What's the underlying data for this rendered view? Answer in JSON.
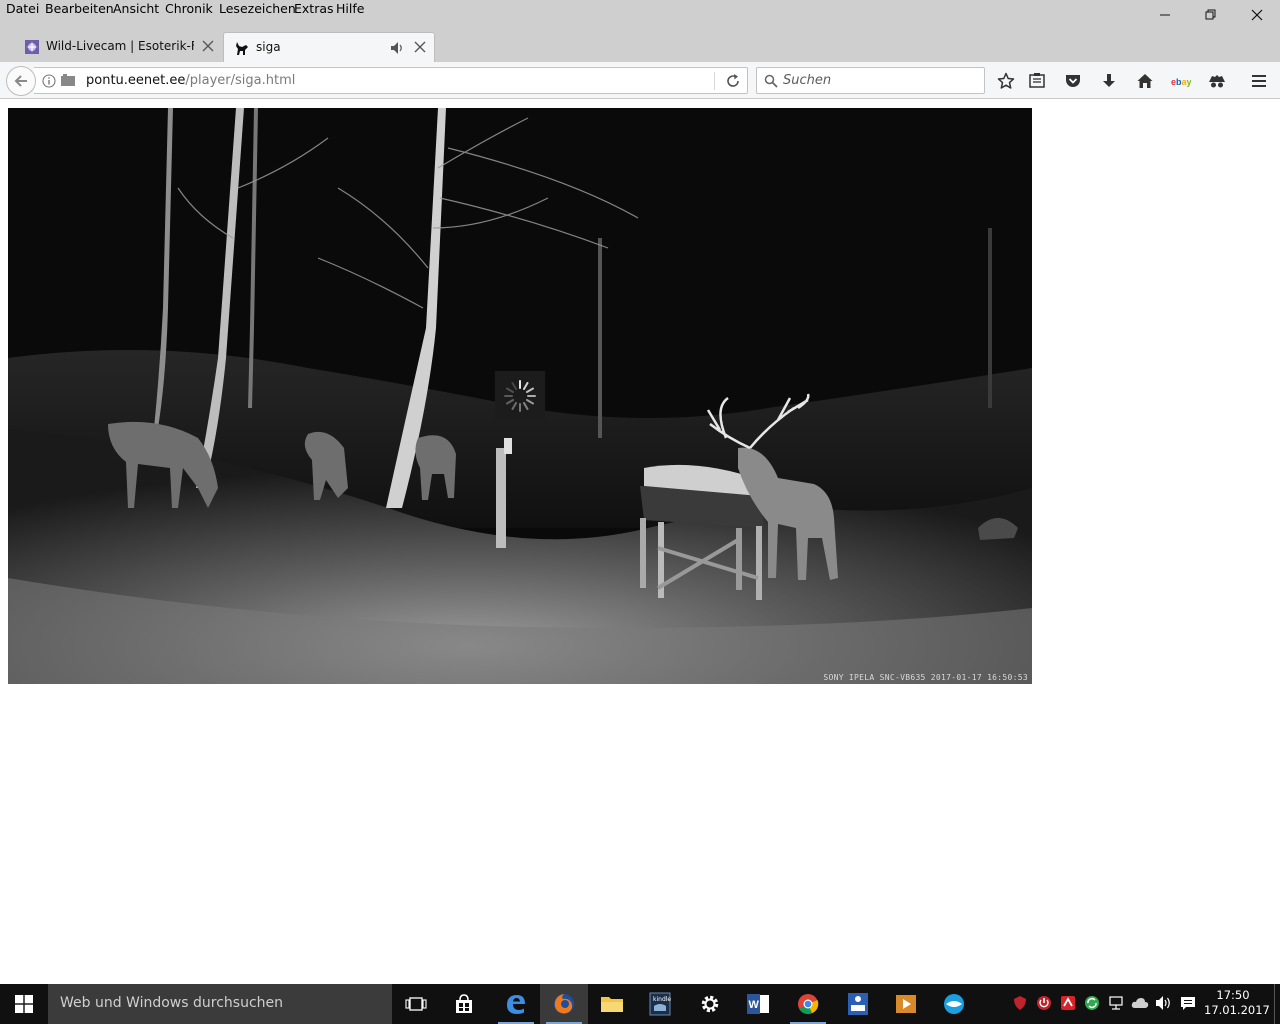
{
  "menu": {
    "items": [
      "Datei",
      "Bearbeiten",
      "Ansicht",
      "Chronik",
      "Lesezeichen",
      "Extras",
      "Hilfe"
    ]
  },
  "tabs": [
    {
      "title": "Wild-Livecam | Esoterik-F...",
      "active": false
    },
    {
      "title": "siga",
      "active": true
    }
  ],
  "navbar": {
    "url_host": "pontu.eenet.ee",
    "url_path": "/player/siga.html",
    "search_placeholder": "Suchen"
  },
  "video": {
    "overlay_text": "SONY IPELA SNC-VB635   2017-01-17 16:50:53"
  },
  "taskbar": {
    "search_placeholder": "Web und Windows durchsuchen",
    "clock_time": "17:50",
    "clock_date": "17.01.2017"
  },
  "colors": {
    "chrome": "#cfcfcf",
    "toolbar": "#f5f6f7",
    "taskbar": "#101010",
    "accent": "#0078d7"
  }
}
